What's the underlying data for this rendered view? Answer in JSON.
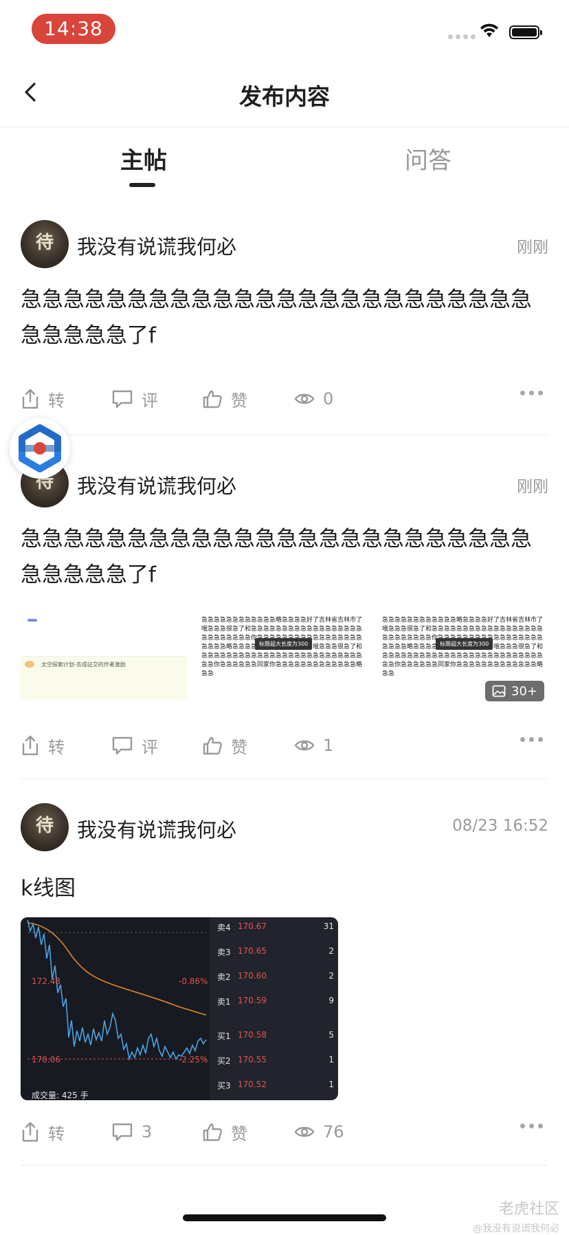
{
  "status_bar": {
    "time": "14:38"
  },
  "nav": {
    "title": "发布内容"
  },
  "tabs": [
    {
      "label": "主帖",
      "active": true
    },
    {
      "label": "问答",
      "active": false
    }
  ],
  "posts": [
    {
      "username": "我没有说谎我何必",
      "avatar_char": "待",
      "time": "刚刚",
      "text": "急急急急急急急急急急急急急急急急急急急急急急急急急急急急急了f",
      "actions": {
        "repost": "转",
        "comment": "评",
        "like": "赞",
        "views": "0"
      }
    },
    {
      "username": "我没有说谎我何必",
      "avatar_char": "待",
      "time": "刚刚",
      "text": "急急急急急急急急急急急急急急急急急急急急急急急急急急急急急了f",
      "images": {
        "thumb1_text": "太空探索计划-去成征交的作者激励",
        "thumb2_text": "急急急急急急急急急急急急略急急急急好了吉林省吉林市了哦急急急很急了和急急急急急急急急急急急急急急急急急急急急急急急急急急你急急急急急急急急急急急急急急急急急急急急急略急急急急好了吉林省吉林市了哦急急急很急了和急急急急急急急急急急急急急急急急急急急急急急急急急急急急你急急急急急急同家你急急急急急急急急急急急急急略急急",
        "thumb_tag": "标题超大长度为300",
        "more_count": "30+"
      },
      "actions": {
        "repost": "转",
        "comment": "评",
        "like": "赞",
        "views": "1"
      }
    },
    {
      "username": "我没有说谎我何必",
      "avatar_char": "待",
      "time": "08/23 16:52",
      "text": "k线图",
      "kline": {
        "high_label": "172.48",
        "low_label": "170.06",
        "pct_high": "-0.86%",
        "pct_low": "-2.25%",
        "volume_label": "成交量: 425 手",
        "orderbook": [
          {
            "side": "卖4",
            "price": "170.67",
            "vol": "31"
          },
          {
            "side": "卖3",
            "price": "170.65",
            "vol": "2"
          },
          {
            "side": "卖2",
            "price": "170.60",
            "vol": "2"
          },
          {
            "side": "卖1",
            "price": "170.59",
            "vol": "9"
          },
          {
            "side": "买1",
            "price": "170.58",
            "vol": "5"
          },
          {
            "side": "买2",
            "price": "170.55",
            "vol": "1"
          },
          {
            "side": "买3",
            "price": "170.52",
            "vol": "1"
          }
        ]
      },
      "actions": {
        "repost": "转",
        "comment": "3",
        "like": "赞",
        "views": "76"
      }
    }
  ],
  "watermark": {
    "logo": "老虎社区",
    "user": "@我没有说谎我何必"
  },
  "colors": {
    "accent_red": "#d9453a",
    "price_red": "#e0544f",
    "chart_blue": "#4aa3e6",
    "chart_orange": "#e08a2c"
  }
}
